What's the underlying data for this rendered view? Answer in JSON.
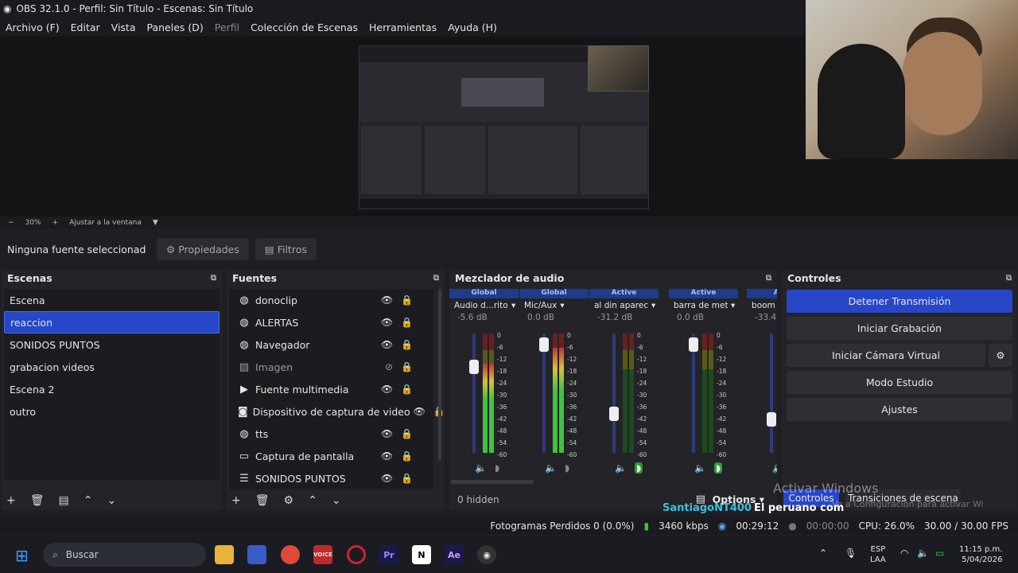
{
  "window": {
    "title": "OBS 32.1.0 - Perfil: Sin Título - Escenas: Sin Título"
  },
  "menu": [
    "Archivo (F)",
    "Editar",
    "Vista",
    "Paneles (D)",
    "Perfil",
    "Colección de Escenas",
    "Herramientas",
    "Ayuda (H)"
  ],
  "zoom": {
    "minus": "−",
    "level": "30%",
    "plus": "+",
    "fit": "Ajustar a la ventana"
  },
  "source_bar": {
    "none_selected": "Ninguna fuente seleccionad",
    "properties": "Propiedades",
    "filters": "Filtros"
  },
  "scenes": {
    "title": "Escenas",
    "items": [
      "Escena",
      "reaccion",
      "SONIDOS PUNTOS",
      "grabacion videos",
      "Escena 2",
      "outro"
    ],
    "selected": "reaccion"
  },
  "sources": {
    "title": "Fuentes",
    "items": [
      {
        "icon": "globe-icon",
        "name": "donoclip"
      },
      {
        "icon": "globe-icon",
        "name": "ALERTAS"
      },
      {
        "icon": "globe-icon",
        "name": "Navegador"
      },
      {
        "icon": "image-icon",
        "name": "Imagen"
      },
      {
        "icon": "play-icon",
        "name": "Fuente multimedia"
      },
      {
        "icon": "camera-icon",
        "name": "Dispositivo de captura de video"
      },
      {
        "icon": "globe-icon",
        "name": "tts"
      },
      {
        "icon": "monitor-icon",
        "name": "Captura de pantalla"
      },
      {
        "icon": "list-icon",
        "name": "SONIDOS PUNTOS"
      }
    ]
  },
  "mixer": {
    "title": "Mezclador de audio",
    "channels": [
      {
        "tag": "Global",
        "name": "Audio d...ritorio",
        "db": "-5.6 dB"
      },
      {
        "tag": "Global",
        "name": "Mic/Aux",
        "db": "0.0 dB"
      },
      {
        "tag": "Active",
        "name": "al din apareciste",
        "db": "-31.2 dB"
      },
      {
        "tag": "Active",
        "name": "barra de metal",
        "db": "0.0 dB"
      },
      {
        "tag": "Acti",
        "name": "boom",
        "db": "-33.4"
      }
    ],
    "scale": [
      "0",
      "-6",
      "-12",
      "-18",
      "-24",
      "-30",
      "-36",
      "-42",
      "-48",
      "-54",
      "-60"
    ],
    "hidden": "0 hidden",
    "options": "Options"
  },
  "controls": {
    "title": "Controles",
    "buttons": [
      "Detener Transmisión",
      "Iniciar Grabación",
      "Iniciar Cámara Virtual",
      "Modo Estudio",
      "Ajustes"
    ],
    "tab_controls": "Controles",
    "tab_transitions": "Transiciones de escena"
  },
  "watermark": {
    "line1": "Activar Windows",
    "line2": "Ve a Configuración para activar Windows."
  },
  "overlay_text": {
    "user": "SantiagoNT400",
    "message": "El peruano com"
  },
  "status": {
    "frames_lost": "Fotogramas Perdidos 0 (0.0%)",
    "kbps": "3460 kbps",
    "live_time": "00:29:12",
    "rec_time": "00:00:00",
    "cpu": "CPU: 26.0%",
    "fps": "30.00 / 30.00 FPS"
  },
  "taskbar": {
    "search": "Buscar",
    "lang1": "ESP",
    "lang2": "LAA",
    "time": "11:15 p.m.",
    "date": "5/04/2026"
  },
  "colors": {
    "accent": "#2747c7",
    "meter_green": "#3ec43e",
    "meter_red": "#c03535"
  }
}
